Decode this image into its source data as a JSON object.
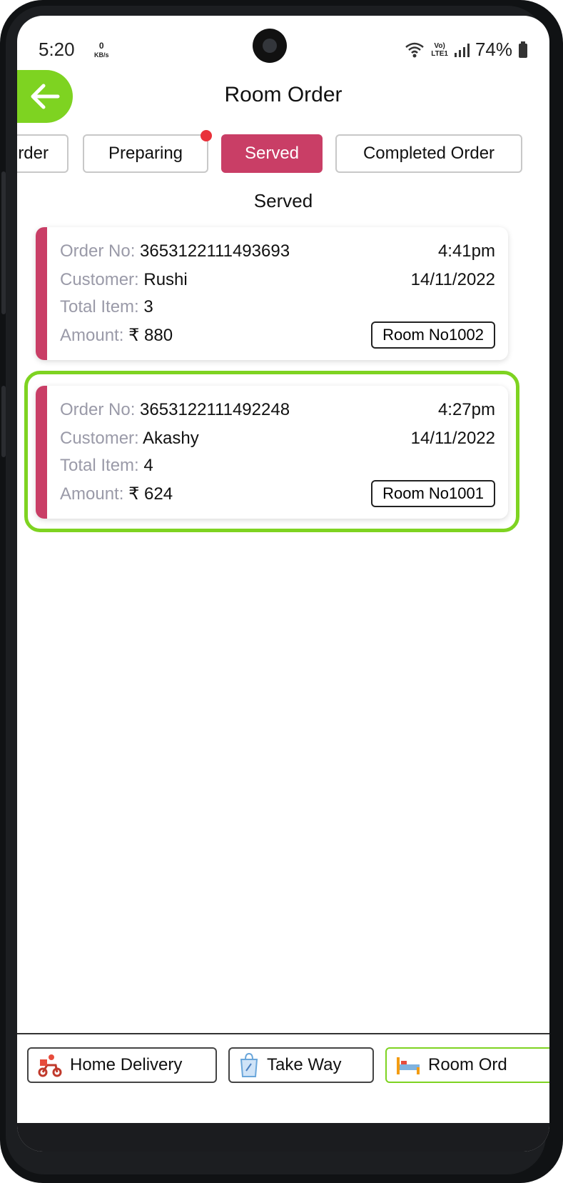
{
  "status_bar": {
    "time": "5:20",
    "net_speed_value": "0",
    "net_speed_unit": "KB/s",
    "network_label_1": "Vo)",
    "network_label_2": "LTE1",
    "battery": "74%"
  },
  "header": {
    "title": "Room Order"
  },
  "tabs": [
    {
      "label": "rder",
      "active": false
    },
    {
      "label": "Preparing",
      "active": false,
      "has_dot": true
    },
    {
      "label": "Served",
      "active": true
    },
    {
      "label": "Completed Order",
      "active": false
    }
  ],
  "section_title": "Served",
  "labels": {
    "order_no": "Order No:",
    "customer": "Customer:",
    "total_item": "Total Item:",
    "amount": "Amount:",
    "room_no": "Room No"
  },
  "orders": [
    {
      "order_no": "3653122111493693",
      "time": "4:41pm",
      "customer": "Rushi",
      "date": "14/11/2022",
      "total_item": "3",
      "amount": "₹ 880",
      "room": "1002"
    },
    {
      "order_no": "3653122111492248",
      "time": "4:27pm",
      "customer": "Akashy",
      "date": "14/11/2022",
      "total_item": "4",
      "amount": "₹ 624",
      "room": "1001",
      "highlighted": true
    }
  ],
  "bottom_nav": [
    {
      "label": "Home Delivery",
      "icon": "delivery-scooter-icon",
      "active": false
    },
    {
      "label": "Take Way",
      "icon": "takeaway-bag-icon",
      "active": false
    },
    {
      "label": "Room Ord",
      "icon": "bed-icon",
      "active": true
    }
  ],
  "colors": {
    "accent": "#c93e66",
    "green": "#7ed321",
    "dot": "#e9313a"
  }
}
